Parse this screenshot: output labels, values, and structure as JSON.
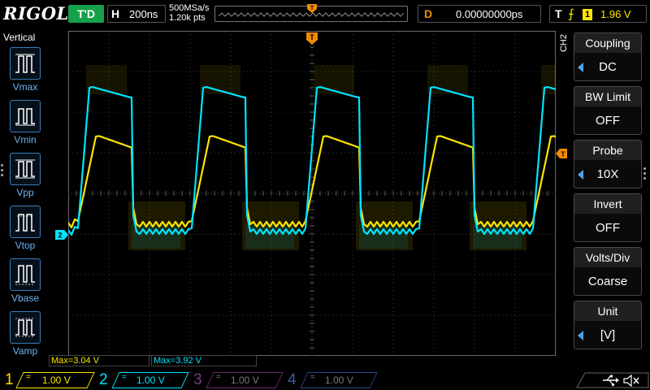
{
  "header": {
    "brand": "RIGOL",
    "run_state": "T'D",
    "horizontal": {
      "label": "H",
      "timebase": "200ns"
    },
    "acquisition": {
      "sample_rate": "500MSa/s",
      "memory_depth": "1.20k pts"
    },
    "delay": {
      "label": "D",
      "value": "0.00000000ps"
    },
    "trigger": {
      "label": "T",
      "edge_symbol": "⨍",
      "source": "1",
      "level": "1.96 V"
    }
  },
  "left_panel": {
    "title": "Vertical",
    "items": [
      {
        "label": "Vmax"
      },
      {
        "label": "Vmin"
      },
      {
        "label": "Vpp"
      },
      {
        "label": "Vtop"
      },
      {
        "label": "Vbase"
      },
      {
        "label": "Vamp"
      }
    ]
  },
  "right_menu": {
    "channel": "CH2",
    "items": [
      {
        "title": "Coupling",
        "value": "DC",
        "has_arrow": true
      },
      {
        "title": "BW Limit",
        "value": "OFF",
        "has_arrow": false
      },
      {
        "title": "Probe",
        "value": "10X",
        "has_arrow": true
      },
      {
        "title": "Invert",
        "value": "OFF",
        "has_arrow": false
      },
      {
        "title": "Volts/Div",
        "value": "Coarse",
        "has_arrow": false
      },
      {
        "title": "Unit",
        "value": "[V]",
        "has_arrow": true
      }
    ]
  },
  "measurements": [
    {
      "text": "Max=3.04 V",
      "channel": 1
    },
    {
      "text": "Max=3.92 V",
      "channel": 2
    }
  ],
  "channels": [
    {
      "number": "1",
      "coupling": "=",
      "scale": "1.00 V",
      "active": true,
      "color": "#ffe400"
    },
    {
      "number": "2",
      "coupling": "=",
      "scale": "1.00 V",
      "active": true,
      "color": "#00e4ff"
    },
    {
      "number": "3",
      "coupling": "=",
      "scale": "1.00 V",
      "active": false,
      "color": "#c23bc2"
    },
    {
      "number": "4",
      "coupling": "=",
      "scale": "1.00 V",
      "active": false,
      "color": "#3a6ee0"
    }
  ],
  "markers": {
    "trigger_position": "T",
    "ch2_ground": "2"
  },
  "colors": {
    "ch1": "#ffe400",
    "ch2": "#00e4ff",
    "trigger": "#f28a00",
    "run_state": "#15a04a",
    "menu_accent": "#4da3e8",
    "grid": "#3c3c3c"
  },
  "icons": {
    "usb": "usb-icon",
    "mute": "speaker-muted-icon"
  }
}
